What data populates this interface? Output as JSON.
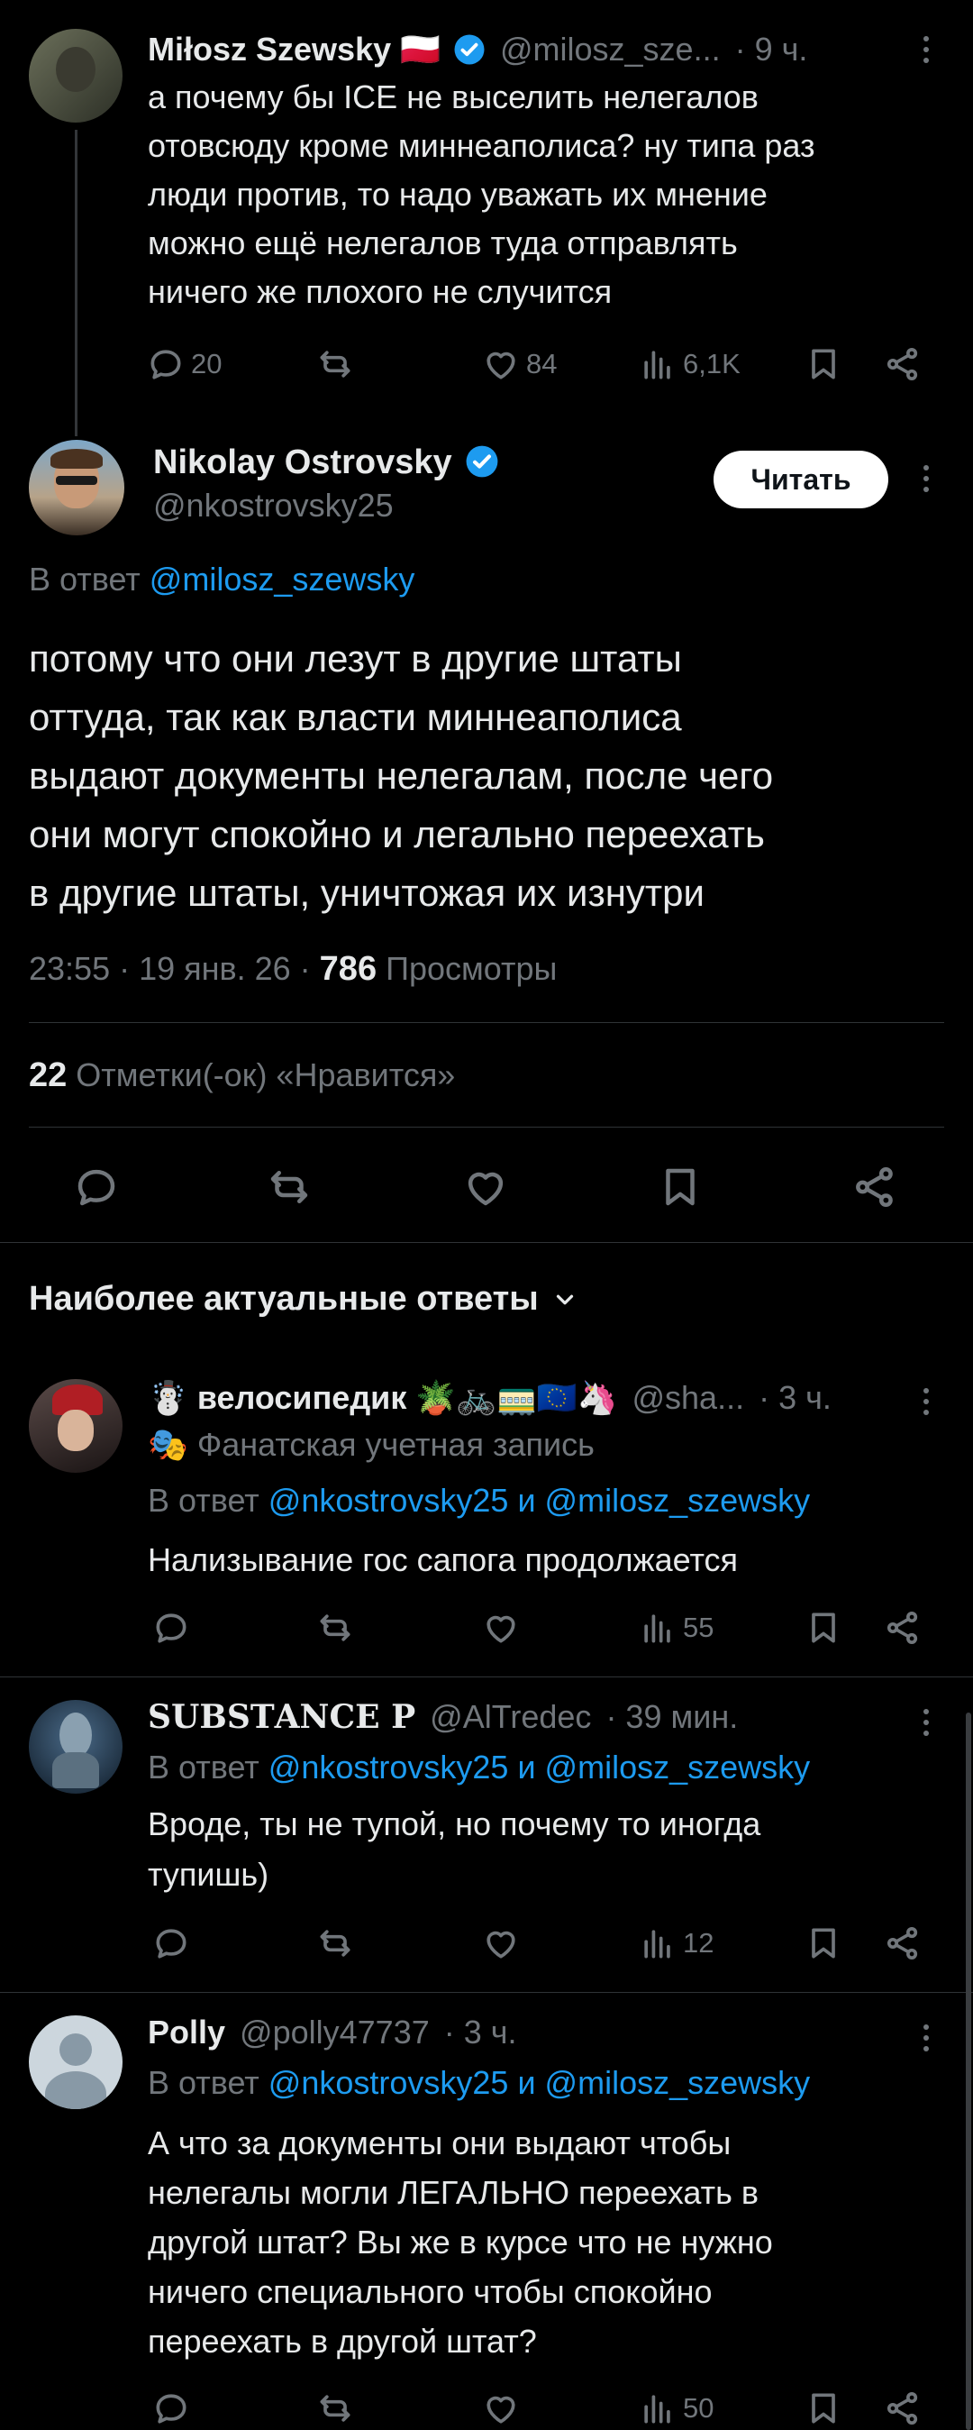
{
  "parent_post": {
    "author_name": "Miłosz Szewsky 🇵🇱",
    "handle": "@milosz_sze...",
    "time": "· 9 ч.",
    "text_lines": [
      "а почему бы ICE не выселить нелегалов",
      "отовсюду кроме миннеаполиса? ну типа раз",
      "люди против, то надо уважать их мнение",
      "можно ещё нелегалов туда отправлять",
      "ничего же плохого не случится"
    ],
    "replies": "20",
    "likes": "84",
    "views": "6,1K"
  },
  "main_post": {
    "author_name": "Nikolay Ostrovsky",
    "handle": "@nkostrovsky25",
    "follow_label": "Читать",
    "reply_to_prefix": "В ответ",
    "reply_to_handle": "@milosz_szewsky",
    "text_lines": [
      "потому что они лезут в другие штаты",
      "оттуда, так как власти миннеаполиса",
      "выдают документы нелегалам, после чего",
      "они могут спокойно и легально переехать",
      "в другие штаты, уничтожая их изнутри"
    ],
    "timestamp": "23:55 · 19 янв. 26 · ",
    "views_count": "786",
    "views_label": " Просмотры",
    "likes_count": "22",
    "likes_label": " Отметки(-ок) «Нравится»"
  },
  "replies_header": "Наиболее актуальные ответы",
  "replies": [
    {
      "author_name": "☃️ велосипедик 🪴🚲🚃🇪🇺🦄",
      "handle": "@sha...",
      "time": "· 3 ч.",
      "subtitle": "🎭 Фанатская учетная запись",
      "reply_prefix": "В ответ",
      "reply_handles": "@nkostrovsky25 и @milosz_szewsky",
      "text_lines": [
        "Нализывание гос сапога продолжается"
      ],
      "views": "55"
    },
    {
      "author_name": "𝐒𝐔𝐁𝐒𝐓𝐀𝐍𝐂𝐄 𝐏",
      "handle": "@AlTredec",
      "time": "· 39 мин.",
      "reply_prefix": "В ответ",
      "reply_handles": "@nkostrovsky25 и @milosz_szewsky",
      "text_lines": [
        "Вроде, ты не тупой, но почему то иногда",
        "тупишь)"
      ],
      "views": "12"
    },
    {
      "author_name": "Polly",
      "handle": "@polly47737",
      "time": "· 3 ч.",
      "reply_prefix": "В ответ",
      "reply_handles": "@nkostrovsky25 и @milosz_szewsky",
      "text_lines": [
        "А что за документы они выдают чтобы",
        "нелегалы могли ЛЕГАЛЬНО переехать в",
        "другой штат? Вы же в курсе что не нужно",
        "ничего специального чтобы спокойно",
        "переехать в другой штат?"
      ],
      "views": "50"
    }
  ],
  "colors": {
    "background": "#000000",
    "text": "#e7e9ea",
    "muted": "#71767b",
    "accent": "#1d9bf0",
    "divider": "#2f3336"
  }
}
